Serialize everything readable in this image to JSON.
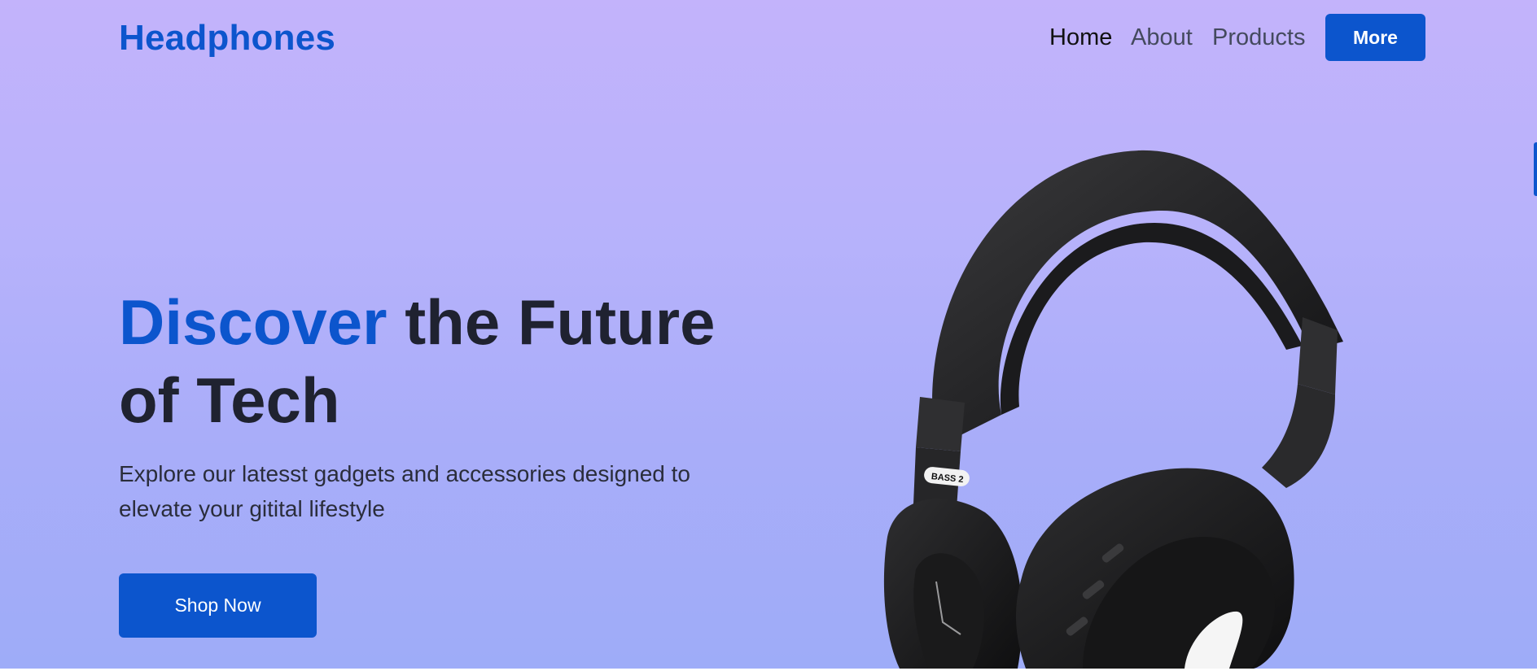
{
  "header": {
    "brand": "Headphones",
    "nav": [
      "Home",
      "About",
      "Products"
    ],
    "more_label": "More"
  },
  "hero": {
    "headline_accent": "Discover",
    "headline_rest_line1": " the Future",
    "headline_line2": "of Tech",
    "subtext": "Explore our latesst gadgets and accessories designed to elevate your gitital lifestyle",
    "cta_label": "Shop Now"
  },
  "product": {
    "label_text": "BASS 2"
  },
  "colors": {
    "accent": "#0c55cd",
    "headline": "#1f2230",
    "bg_top": "#c3b3fb",
    "bg_bottom": "#9eacf8"
  }
}
